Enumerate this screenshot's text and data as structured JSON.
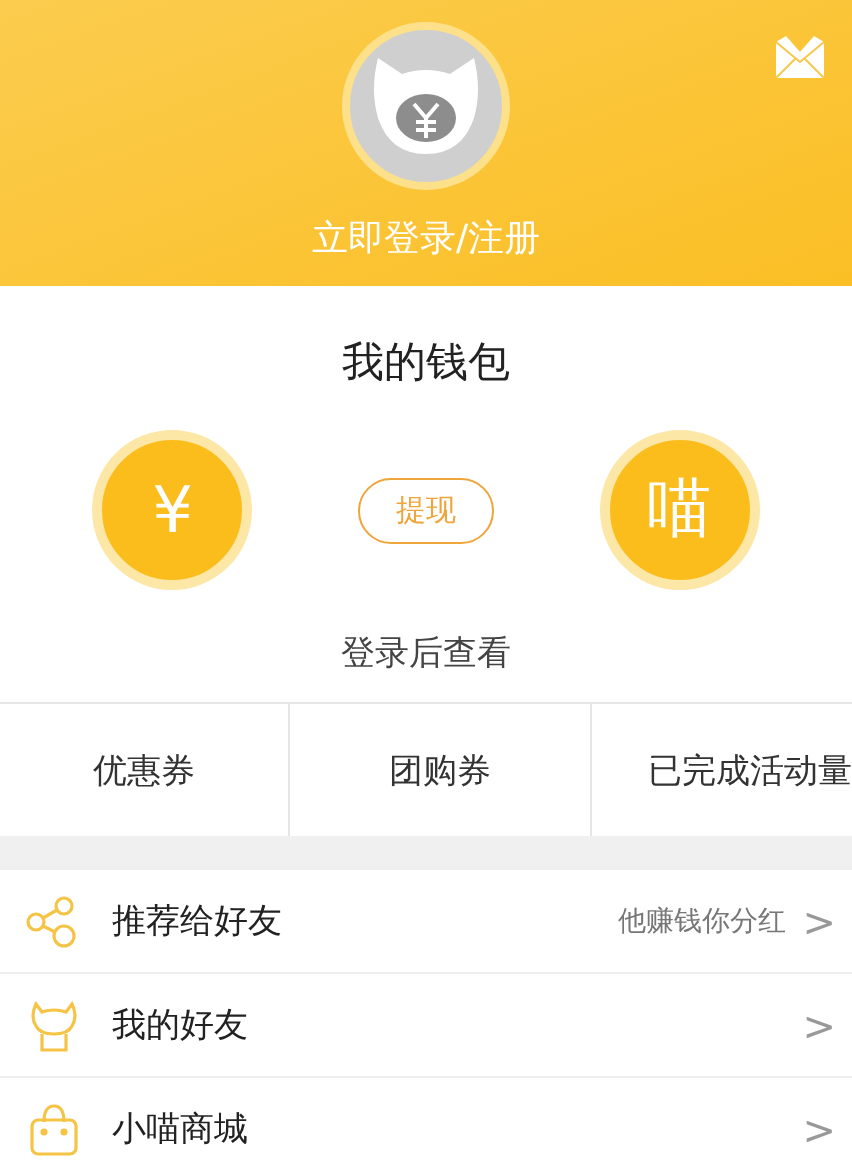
{
  "header": {
    "login_label": "立即登录/注册"
  },
  "wallet": {
    "title": "我的钱包",
    "left_circle": "¥",
    "withdraw_button": "提现",
    "right_circle": "喵",
    "hint": "登录后查看"
  },
  "tabs": [
    {
      "label": "优惠券"
    },
    {
      "label": "团购券"
    },
    {
      "label": "已完成活动量"
    }
  ],
  "menu": [
    {
      "kind": "share",
      "label": "推荐给好友",
      "note": "他赚钱你分红",
      "chevron": ">"
    },
    {
      "kind": "friends",
      "label": "我的好友",
      "chevron": ">"
    },
    {
      "kind": "shop",
      "label": "小喵商城",
      "chevron": ">"
    }
  ]
}
